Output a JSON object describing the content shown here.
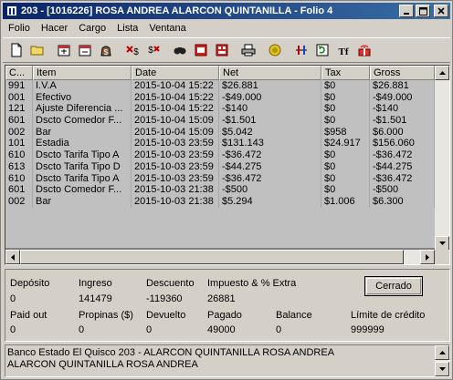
{
  "window": {
    "title": "203 - [1016226] ROSA ANDREA ALARCON QUINTANILLA - Folio 4"
  },
  "menu": [
    "Folio",
    "Hacer",
    "Cargo",
    "Lista",
    "Ventana"
  ],
  "toolbar": {
    "buttons": [
      "new-icon",
      "open-icon",
      "post-charge-icon",
      "split-icon",
      "money-icon",
      "cross-charge-icon",
      "transfer-icon",
      "search-icon",
      "print-preview-icon",
      "print-all-icon",
      "printer-icon",
      "coin-icon",
      "adjust-icon",
      "refresh-icon",
      "tf-icon",
      "gift-icon"
    ]
  },
  "grid": {
    "headers": [
      "C...",
      "Item",
      "Date",
      "Net",
      "Tax",
      "Gross"
    ],
    "rows": [
      [
        "991",
        "I.V.A",
        "2015-10-04 15:22",
        "$26.881",
        "$0",
        "$26.881"
      ],
      [
        "001",
        "Efectivo",
        "2015-10-04 15:22",
        "-$49.000",
        "$0",
        "-$49.000"
      ],
      [
        "121",
        "Ajuste Diferencia ...",
        "2015-10-04 15:22",
        "-$140",
        "$0",
        "-$140"
      ],
      [
        "601",
        "Dscto Comedor F...",
        "2015-10-04 15:09",
        "-$1.501",
        "$0",
        "-$1.501"
      ],
      [
        "002",
        "Bar",
        "2015-10-04 15:09",
        "$5.042",
        "$958",
        "$6.000"
      ],
      [
        "101",
        "Estadia",
        "2015-10-03 23:59",
        "$131.143",
        "$24.917",
        "$156.060"
      ],
      [
        "610",
        "Dscto Tarifa Tipo A",
        "2015-10-03 23:59",
        "-$36.472",
        "$0",
        "-$36.472"
      ],
      [
        "613",
        "Dscto Tarifa Tipo D",
        "2015-10-03 23:59",
        "-$44.275",
        "$0",
        "-$44.275"
      ],
      [
        "610",
        "Dscto Tarifa Tipo A",
        "2015-10-03 23:59",
        "-$36.472",
        "$0",
        "-$36.472"
      ],
      [
        "601",
        "Dscto Comedor F...",
        "2015-10-03 21:38",
        "-$500",
        "$0",
        "-$500"
      ],
      [
        "002",
        "Bar",
        "2015-10-03 21:38",
        "$5.294",
        "$1.006",
        "$6.300"
      ]
    ]
  },
  "summary": {
    "deposito_label": "Depósito",
    "deposito": "0",
    "ingreso_label": "Ingreso",
    "ingreso": "141479",
    "descuento_label": "Descuento",
    "descuento": "-119360",
    "impuesto_label": "Impuesto & % Extra",
    "impuesto": "26881",
    "paid_out_label": "Paid out",
    "paid_out": "0",
    "propinas_label": "Propinas ($)",
    "propinas": "0",
    "devuelto_label": "Devuelto",
    "devuelto": "0",
    "pagado_label": "Pagado",
    "pagado": "49000",
    "balance_label": "Balance",
    "balance": "0",
    "limite_label": "Límite de crédito",
    "limite": "999999",
    "status_button": "Cerrado"
  },
  "status": {
    "line1": "Banco Estado El Quisco 203 - ALARCON QUINTANILLA ROSA ANDREA",
    "line2": "ALARCON QUINTANILLA  ROSA ANDREA"
  }
}
